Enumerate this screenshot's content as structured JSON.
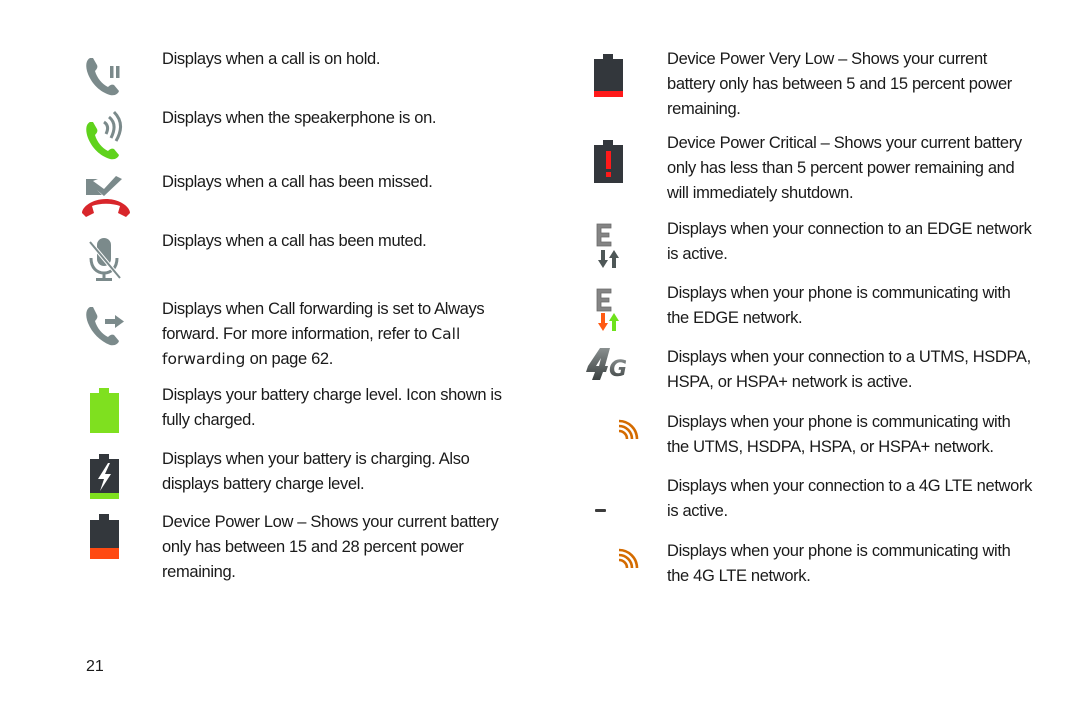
{
  "page_number": "21",
  "colors": {
    "icon_gray": "#7b8a8b",
    "call_green": "#5fd21c",
    "missed_red": "#d8262b",
    "battery_dark": "#33373c",
    "battery_full_green": "#7fe01f",
    "battery_low_orange": "#ff4a12",
    "battery_critical_red": "#ff1a1a",
    "arrow_orange": "#ff5a13",
    "arrow_green": "#6ee21c",
    "signal_orange": "#d46b00"
  },
  "left_column": [
    {
      "icon": "call-on-hold-icon",
      "lines": [
        "Displays when a call is on hold."
      ]
    },
    {
      "icon": "speakerphone-icon",
      "lines": [
        "Displays when the speakerphone is on."
      ]
    },
    {
      "icon": "missed-call-icon",
      "lines": [
        "Displays when a call has been missed."
      ]
    },
    {
      "icon": "call-muted-icon",
      "lines": [
        "Displays when a call has been muted."
      ]
    },
    {
      "icon": "call-forwarding-icon",
      "lines": [
        "Displays when Call forwarding is set to Always",
        "forward. For more information, refer to "
      ],
      "ref_line1": "Call",
      "ref_line2": "forwarding",
      "line3_suffix": " on page 62."
    },
    {
      "icon": "battery-full-icon",
      "lines": [
        "Displays your battery charge level. Icon shown is",
        "fully charged."
      ]
    },
    {
      "icon": "battery-charging-icon",
      "lines": [
        "Displays when your battery is charging. Also",
        "displays battery charge level."
      ]
    },
    {
      "icon": "battery-low-icon",
      "lines": [
        "Device Power Low – Shows your current battery",
        "only has between 15 and 28 percent power",
        "remaining."
      ]
    }
  ],
  "right_column": [
    {
      "icon": "battery-very-low-icon",
      "lines": [
        "Device Power Very Low – Shows your current",
        "battery only has between 5 and 15 percent power",
        "remaining."
      ]
    },
    {
      "icon": "battery-critical-icon",
      "lines": [
        "Device Power Critical – Shows your current battery",
        "only has less than 5 percent power remaining and",
        "will immediately shutdown."
      ]
    },
    {
      "icon": "edge-network-active-icon",
      "lines": [
        "Displays when your connection to an EDGE network",
        "is active."
      ]
    },
    {
      "icon": "edge-network-communicating-icon",
      "lines": [
        "Displays when your phone is communicating with",
        "the EDGE network."
      ]
    },
    {
      "icon": "4g-network-icon",
      "label": "4G",
      "lines": [
        "Displays when your connection to a UTMS, HSDPA,",
        "HSPA, or HSPA+ network is active."
      ]
    },
    {
      "icon": "4g-communicating-icon",
      "lines": [
        "Displays when your phone is communicating with",
        "the UTMS, HSDPA, HSPA, or HSPA+ network."
      ]
    },
    {
      "icon": "4g-lte-network-icon",
      "lines": [
        "Displays when your connection to a 4G LTE network",
        "is active."
      ]
    },
    {
      "icon": "4g-lte-communicating-icon",
      "lines": [
        "Displays when your phone is communicating with",
        "the 4G LTE network."
      ]
    }
  ],
  "edge_letter": "E"
}
